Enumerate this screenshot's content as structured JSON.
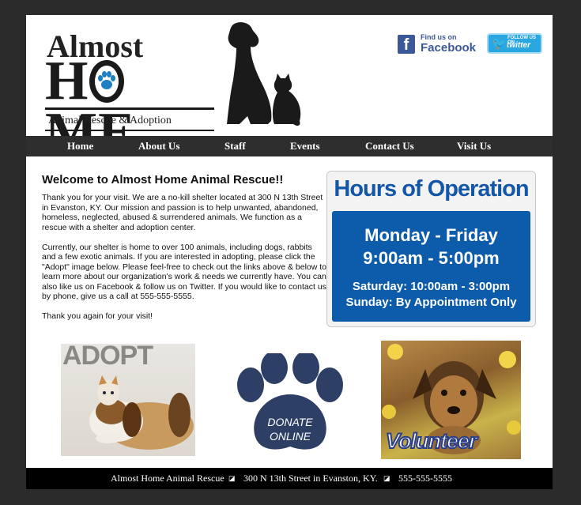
{
  "logo": {
    "line1": "Almost",
    "line2_left": "H",
    "line2_right": "ME",
    "tagline": "Animal Rescue & Adoption"
  },
  "social": {
    "facebook_small": "Find us on",
    "facebook_big": "Facebook",
    "twitter_small": "FOLLOW US ON",
    "twitter_big": "twitter"
  },
  "nav": [
    "Home",
    "About Us",
    "Staff",
    "Events",
    "Contact Us",
    "Visit Us"
  ],
  "welcome": {
    "title": "Welcome to Almost Home Animal Rescue!!",
    "paragraphs": [
      "Thank you for your visit. We are a no-kill shelter located at 300 N 13th Street in Evanston, KY. Our mission and passion is to help unwanted, abandoned, homeless, neglected, abused & surrendered animals. We function as a rescue with a shelter and adoption center.",
      "Currently, our shelter is home to over 100 animals, including dogs, rabbits and a few exotic animals. If you are interested in adopting, please click the \"Adopt\" image below. Please feel-free to check out the links above & below to learn more about our organization's work & needs we currently have. You can also like us on Facebook & follow us on Twitter. If you would like to contact us by phone, give us a call at 555-555-5555.",
      "Thank you again for your visit!"
    ]
  },
  "hours": {
    "title": "Hours of Operation",
    "days": "Monday - Friday",
    "times": "9:00am - 5:00pm",
    "saturday": "Saturday: 10:00am - 3:00pm",
    "sunday": "Sunday: By Appointment Only"
  },
  "tiles": {
    "adopt": "ADOPT",
    "donate_line1": "DONATE",
    "donate_line2": "ONLINE",
    "volunteer": "Volunteer"
  },
  "footer": {
    "name": "Almost Home Animal Rescue",
    "address": "300 N 13th Street in Evanston, KY.",
    "phone": "555-555-5555"
  },
  "colors": {
    "background": "#2b2b2b",
    "nav": "#2e2e2e",
    "hours_blue": "#0d5cab",
    "paw": "#2e3f66"
  }
}
